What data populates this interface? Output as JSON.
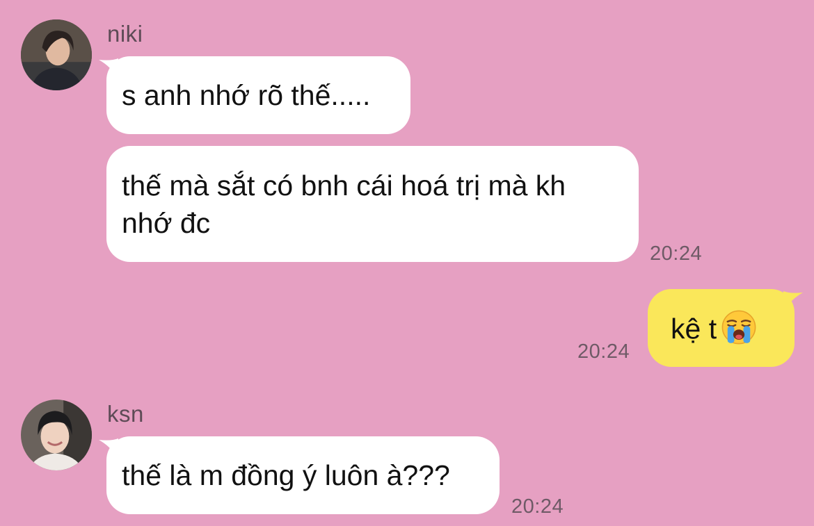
{
  "messages": [
    {
      "sender": "niki",
      "avatar_icon": "avatar-photo-icon",
      "bubbles": [
        {
          "text": "s anh nhớ rõ thế....."
        },
        {
          "text": "thế mà sắt có bnh cái hoá trị mà kh nhớ đc"
        }
      ],
      "time": "20:24"
    },
    {
      "sender": "me",
      "bubbles": [
        {
          "text": "kệ t",
          "emoji": "loudly-crying-face-icon"
        }
      ],
      "time": "20:24"
    },
    {
      "sender": "ksn",
      "avatar_icon": "avatar-photo-icon",
      "bubbles": [
        {
          "text": "thế là m đồng ý luôn à???"
        }
      ],
      "time": "20:24"
    }
  ],
  "colors": {
    "background": "#e6a0c2",
    "incoming_bubble": "#ffffff",
    "outgoing_bubble": "#fae75a",
    "timestamp": "#6e5a66"
  }
}
